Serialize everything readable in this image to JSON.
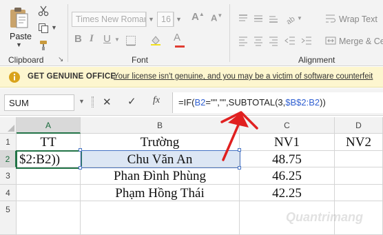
{
  "ribbon": {
    "clipboard": {
      "paste_label": "Paste",
      "group_label": "Clipboard",
      "launcher_glyph": "↘"
    },
    "font": {
      "font_name": "Times New Roman",
      "font_size": "16",
      "group_label": "Font"
    },
    "alignment": {
      "wrap_text_label": "Wrap Text",
      "merge_label": "Merge & Cen",
      "group_label": "Alignment"
    }
  },
  "message_bar": {
    "title": "GET GENUINE OFFICE",
    "body": "Your license isn't genuine, and you may be a victim of software counterfeit"
  },
  "formula_bar": {
    "name_box": "SUM",
    "cancel_glyph": "✕",
    "enter_glyph": "✓",
    "fx_label": "fx",
    "formula_parts": {
      "p1": "=IF(",
      "p2": "B2",
      "p3": "=\"\",\"\",SUBTOTAL(3,",
      "p4": "$B$2:B2",
      "p5": "))"
    }
  },
  "grid": {
    "columns": [
      "A",
      "B",
      "C",
      "D"
    ],
    "rows": [
      "1",
      "2",
      "3",
      "4",
      "5"
    ],
    "cells": {
      "A1": "TT",
      "B1": "Trường",
      "C1": "NV1",
      "D1": "NV2",
      "A2": "$2:B2))",
      "B2": "Chu Văn An",
      "C2": "48.75",
      "B3": "Phan Đình Phùng",
      "C3": "46.25",
      "B4": "Phạm Hồng Thái",
      "C4": "42.25"
    }
  },
  "annotation": {
    "arrow_color": "#e02020"
  },
  "watermark": "Quantrimang"
}
